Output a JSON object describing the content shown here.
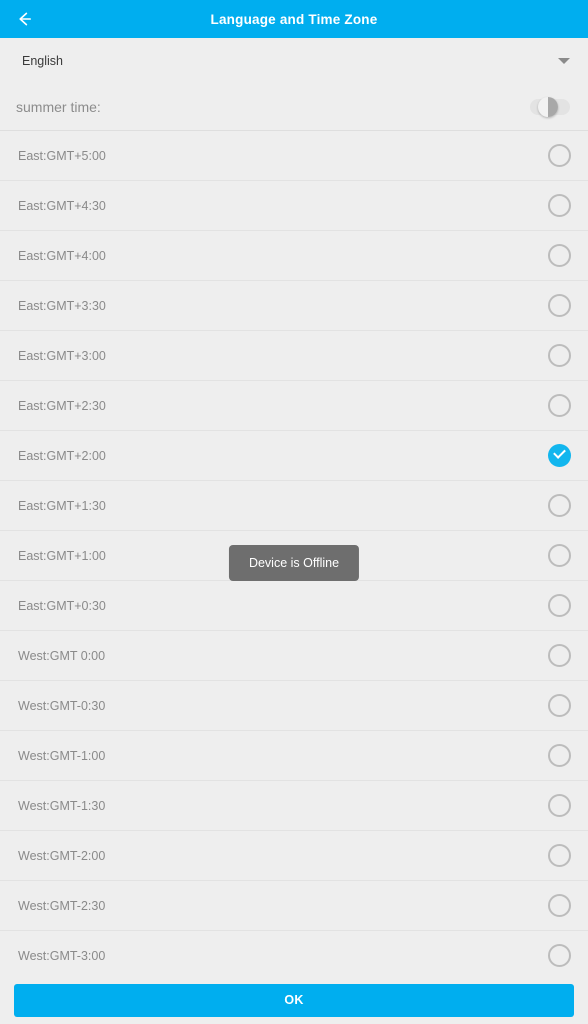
{
  "header": {
    "title": "Language and Time Zone",
    "back_icon": "arrow-left-icon",
    "background_color": "#00AEEF"
  },
  "language": {
    "label": "English",
    "caret_icon": "chevron-down-icon"
  },
  "summer_time": {
    "label": "summer time:",
    "enabled": false
  },
  "timezones": [
    {
      "label": "East:GMT+5:00",
      "selected": false
    },
    {
      "label": "East:GMT+4:30",
      "selected": false
    },
    {
      "label": "East:GMT+4:00",
      "selected": false
    },
    {
      "label": "East:GMT+3:30",
      "selected": false
    },
    {
      "label": "East:GMT+3:00",
      "selected": false
    },
    {
      "label": "East:GMT+2:30",
      "selected": false
    },
    {
      "label": "East:GMT+2:00",
      "selected": true
    },
    {
      "label": "East:GMT+1:30",
      "selected": false
    },
    {
      "label": "East:GMT+1:00",
      "selected": false
    },
    {
      "label": "East:GMT+0:30",
      "selected": false
    },
    {
      "label": "West:GMT 0:00",
      "selected": false
    },
    {
      "label": "West:GMT-0:30",
      "selected": false
    },
    {
      "label": "West:GMT-1:00",
      "selected": false
    },
    {
      "label": "West:GMT-1:30",
      "selected": false
    },
    {
      "label": "West:GMT-2:00",
      "selected": false
    },
    {
      "label": "West:GMT-2:30",
      "selected": false
    },
    {
      "label": "West:GMT-3:00",
      "selected": false
    }
  ],
  "toast": {
    "message": "Device is Offline"
  },
  "footer": {
    "ok_label": "OK"
  },
  "colors": {
    "accent": "#00AEEF",
    "selected": "#12B6EE",
    "background": "#eeeeee",
    "divider": "#e2e2e2",
    "toast_background": "#6e6e6e"
  }
}
